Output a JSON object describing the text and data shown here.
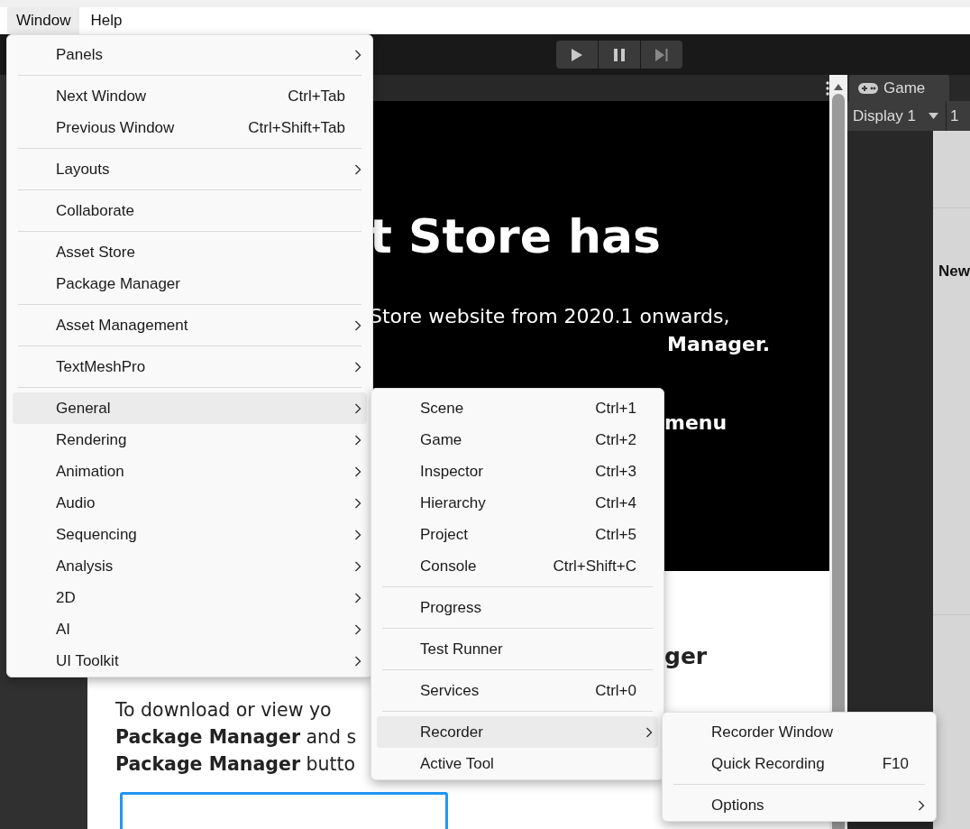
{
  "menu_bar": [
    {
      "label": "Window",
      "selected": true
    },
    {
      "label": "Help",
      "selected": false
    }
  ],
  "asset_store_panel": {
    "headline": "t Store has",
    "line_1": "Store website from 2020.1 onwards,",
    "line_2": "Manager.",
    "line_3": "menu",
    "subheading": "ger",
    "paragraph": [
      "To download or view yo",
      "**Package Manager** and s",
      "**Package Manager** butto"
    ]
  },
  "game_panel": {
    "tab": "Game",
    "display": "Display 1",
    "resolution": "1",
    "label": "New"
  },
  "window_menu": [
    {
      "kind": "item",
      "label": "Panels",
      "submenu": true,
      "selected": false
    },
    {
      "kind": "separator"
    },
    {
      "kind": "item",
      "label": "Next Window",
      "shortcut": "Ctrl+Tab",
      "submenu": false,
      "selected": false
    },
    {
      "kind": "item",
      "label": "Previous Window",
      "shortcut": "Ctrl+Shift+Tab",
      "submenu": false,
      "selected": false
    },
    {
      "kind": "separator"
    },
    {
      "kind": "item",
      "label": "Layouts",
      "submenu": true,
      "selected": false
    },
    {
      "kind": "separator"
    },
    {
      "kind": "item",
      "label": "Collaborate",
      "submenu": false,
      "selected": false
    },
    {
      "kind": "separator"
    },
    {
      "kind": "item",
      "label": "Asset Store",
      "submenu": false,
      "selected": false
    },
    {
      "kind": "item",
      "label": "Package Manager",
      "submenu": false,
      "selected": false
    },
    {
      "kind": "separator"
    },
    {
      "kind": "item",
      "label": "Asset Management",
      "submenu": true,
      "selected": false
    },
    {
      "kind": "separator"
    },
    {
      "kind": "item",
      "label": "TextMeshPro",
      "submenu": true,
      "selected": false
    },
    {
      "kind": "separator"
    },
    {
      "kind": "item",
      "label": "General",
      "submenu": true,
      "selected": true
    },
    {
      "kind": "item",
      "label": "Rendering",
      "submenu": true,
      "selected": false
    },
    {
      "kind": "item",
      "label": "Animation",
      "submenu": true,
      "selected": false
    },
    {
      "kind": "item",
      "label": "Audio",
      "submenu": true,
      "selected": false
    },
    {
      "kind": "item",
      "label": "Sequencing",
      "submenu": true,
      "selected": false
    },
    {
      "kind": "item",
      "label": "Analysis",
      "submenu": true,
      "selected": false
    },
    {
      "kind": "item",
      "label": "2D",
      "submenu": true,
      "selected": false
    },
    {
      "kind": "item",
      "label": "AI",
      "submenu": true,
      "selected": false
    },
    {
      "kind": "item",
      "label": "UI Toolkit",
      "submenu": true,
      "selected": false
    }
  ],
  "general_menu": [
    {
      "kind": "item",
      "label": "Scene",
      "shortcut": "Ctrl+1",
      "submenu": false,
      "selected": false
    },
    {
      "kind": "item",
      "label": "Game",
      "shortcut": "Ctrl+2",
      "submenu": false,
      "selected": false
    },
    {
      "kind": "item",
      "label": "Inspector",
      "shortcut": "Ctrl+3",
      "submenu": false,
      "selected": false
    },
    {
      "kind": "item",
      "label": "Hierarchy",
      "shortcut": "Ctrl+4",
      "submenu": false,
      "selected": false
    },
    {
      "kind": "item",
      "label": "Project",
      "shortcut": "Ctrl+5",
      "submenu": false,
      "selected": false
    },
    {
      "kind": "item",
      "label": "Console",
      "shortcut": "Ctrl+Shift+C",
      "submenu": false,
      "selected": false
    },
    {
      "kind": "separator"
    },
    {
      "kind": "item",
      "label": "Progress",
      "submenu": false,
      "selected": false
    },
    {
      "kind": "separator"
    },
    {
      "kind": "item",
      "label": "Test Runner",
      "submenu": false,
      "selected": false
    },
    {
      "kind": "separator"
    },
    {
      "kind": "item",
      "label": "Services",
      "shortcut": "Ctrl+0",
      "submenu": false,
      "selected": false
    },
    {
      "kind": "separator"
    },
    {
      "kind": "item",
      "label": "Recorder",
      "submenu": true,
      "selected": true
    },
    {
      "kind": "item",
      "label": "Active Tool",
      "submenu": false,
      "selected": false
    }
  ],
  "recorder_menu": [
    {
      "kind": "item",
      "label": "Recorder Window",
      "submenu": false,
      "selected": false
    },
    {
      "kind": "item",
      "label": "Quick Recording",
      "shortcut": "F10",
      "submenu": false,
      "selected": false
    },
    {
      "kind": "separator"
    },
    {
      "kind": "item",
      "label": "Options",
      "submenu": true,
      "selected": false
    }
  ]
}
